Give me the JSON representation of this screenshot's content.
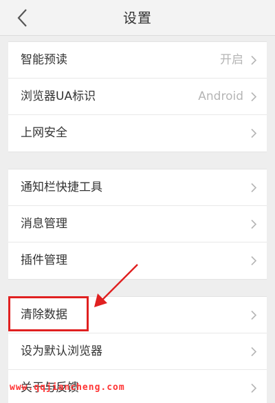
{
  "header": {
    "title": "设置",
    "back_icon": "chevron-left-icon"
  },
  "groups": [
    {
      "items": [
        {
          "label": "智能预读",
          "value": "开启"
        },
        {
          "label": "浏览器UA标识",
          "value": "Android"
        },
        {
          "label": "上网安全",
          "value": ""
        }
      ]
    },
    {
      "items": [
        {
          "label": "通知栏快捷工具",
          "value": ""
        },
        {
          "label": "消息管理",
          "value": ""
        },
        {
          "label": "插件管理",
          "value": ""
        }
      ]
    },
    {
      "items": [
        {
          "label": "清除数据",
          "value": ""
        },
        {
          "label": "设为默认浏览器",
          "value": ""
        },
        {
          "label": "关于与反馈",
          "value": ""
        }
      ]
    }
  ],
  "annotation": {
    "highlight_color": "#e02020"
  },
  "watermark": "www.qqjiancheng.com",
  "colors": {
    "background": "#eeeeee",
    "header_bg": "#f3f3f3",
    "text": "#333333",
    "secondary_text": "#b5b5b5"
  }
}
